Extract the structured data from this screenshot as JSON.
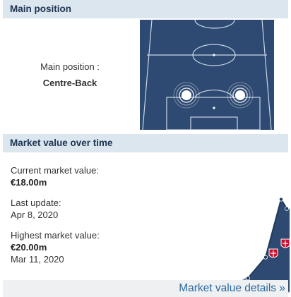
{
  "main_position_panel": {
    "title": "Main position",
    "label": "Main position :",
    "value": "Centre-Back"
  },
  "market_value_panel": {
    "title": "Market value over time",
    "current_label": "Current market value:",
    "current_value": "€18.00m",
    "last_update_label": "Last update:",
    "last_update_value": "Apr 8, 2020",
    "highest_label": "Highest market value:",
    "highest_value": "€20.00m",
    "highest_date": "Mar 11, 2020",
    "details_link": "Market value details »"
  },
  "colors": {
    "header_bg": "#dbe6ef",
    "pitch": "#2e4a72",
    "chart_fill": "#2e4a72",
    "link": "#2b6aa0"
  },
  "chart_data": {
    "type": "area",
    "x_index": [
      0,
      1,
      2,
      3,
      4,
      5,
      6,
      7
    ],
    "values": [
      0.2,
      0.3,
      1.2,
      1.0,
      3.0,
      7.5,
      20.0,
      18.0
    ],
    "ylim": [
      0,
      21
    ],
    "markers": [
      "club-crest-icon",
      "club-crest-icon",
      "club-crest-icon"
    ]
  }
}
